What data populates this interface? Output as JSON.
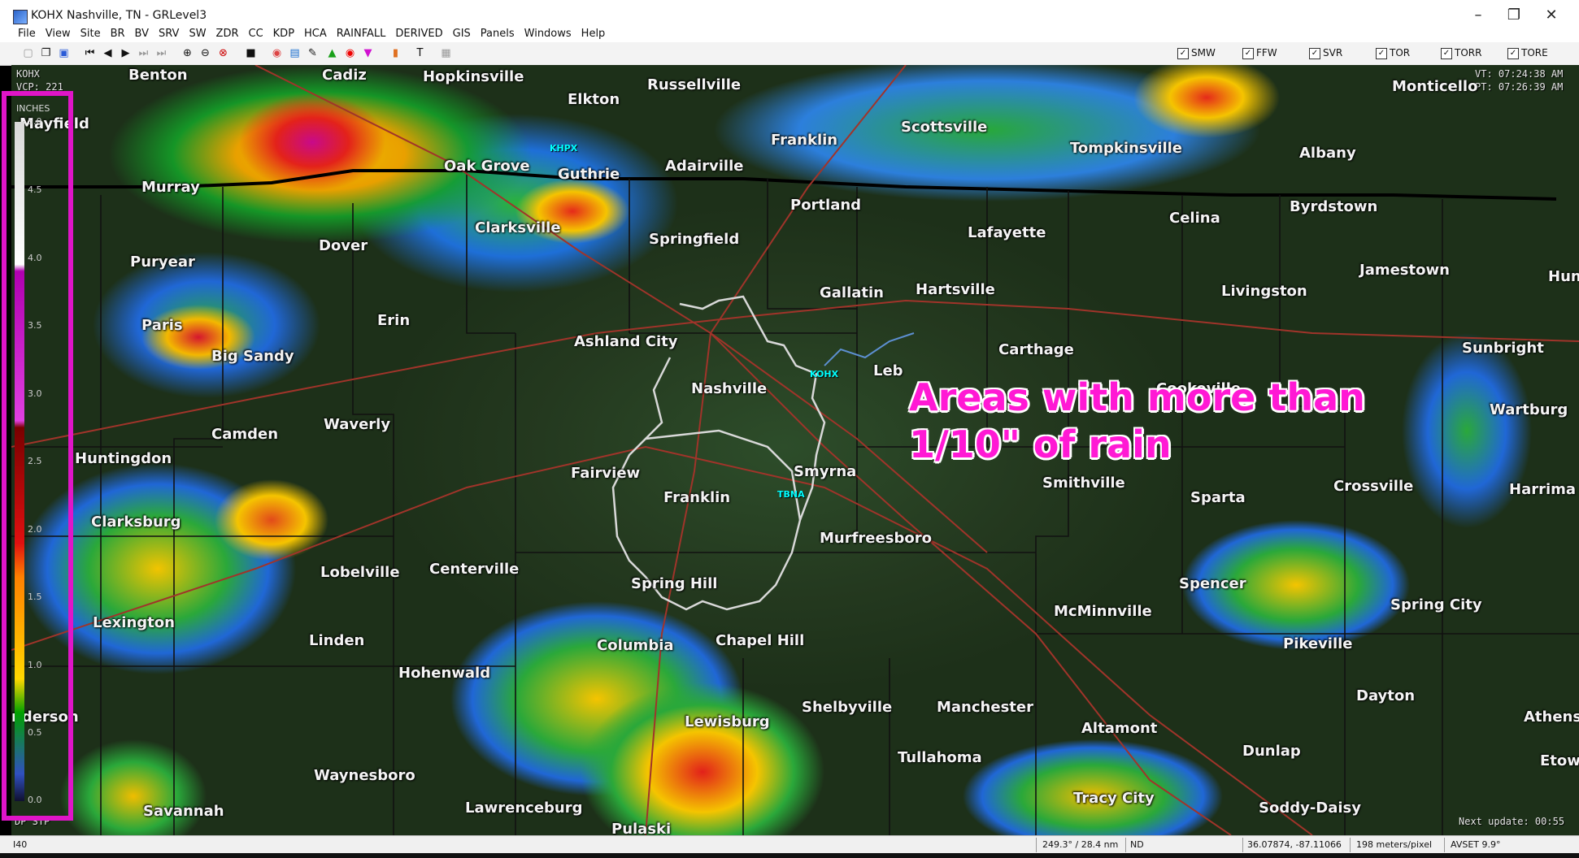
{
  "window": {
    "title": "KOHX Nashville, TN - GRLevel3",
    "controls": [
      "–",
      "❐",
      "✕"
    ]
  },
  "menu": [
    "File",
    "View",
    "Site",
    "BR",
    "BV",
    "SRV",
    "SW",
    "ZDR",
    "CC",
    "KDP",
    "HCA",
    "RAINFALL",
    "DERIVED",
    "GIS",
    "Panels",
    "Windows",
    "Help"
  ],
  "toolbar_icons": [
    "copy-icon",
    "copy-image-icon",
    "export-icon",
    "first-frame-icon",
    "prev-frame-icon",
    "play-icon",
    "next-frame-icon",
    "last-frame-icon",
    "zoom-in-icon",
    "zoom-out-icon",
    "zoom-reset-icon",
    "stop-icon",
    "radar-icon",
    "layers-icon",
    "pen-icon",
    "triangle-green-icon",
    "circle-red-icon",
    "triangle-magenta-icon",
    "fill-icon",
    "text-icon",
    "grid-icon"
  ],
  "warnings": [
    {
      "label": "SMW",
      "checked": true
    },
    {
      "label": "FFW",
      "checked": true
    },
    {
      "label": "SVR",
      "checked": true
    },
    {
      "label": "TOR",
      "checked": true
    },
    {
      "label": "TORR",
      "checked": true
    },
    {
      "label": "TORE",
      "checked": true
    }
  ],
  "hud": {
    "site": "KOHX",
    "vcp": "VCP: 221",
    "vt": "VT: 07:24:38 AM",
    "pt": "PT: 07:26:39 AM",
    "product": "DP STP",
    "next_update": "Next update: 00:55"
  },
  "legend": {
    "unit": "INCHES",
    "ticks": [
      "5.0",
      "4.5",
      "4.0",
      "3.5",
      "3.0",
      "2.5",
      "2.0",
      "1.5",
      "1.0",
      "0.5",
      "0.0"
    ]
  },
  "annotation": {
    "line1": "Areas with more than",
    "line2": "1/10\" of rain"
  },
  "radar_sites": [
    "KHPX",
    "KOHX",
    "TBNA"
  ],
  "cities": {
    "benton": "Benton",
    "cadiz": "Cadiz",
    "hopkinsville": "Hopkinsville",
    "russellville": "Russellville",
    "elkton": "Elkton",
    "monticello": "Monticello",
    "mayfield": "Mayfield",
    "franklin_ky": "Franklin",
    "scottsville": "Scottsville",
    "murray": "Murray",
    "oak_grove": "Oak Grove",
    "guthrie": "Guthrie",
    "adairville": "Adairville",
    "tompkinsville": "Tompkinsville",
    "albany": "Albany",
    "clarksville": "Clarksville",
    "dover": "Dover",
    "springfield": "Springfield",
    "portland": "Portland",
    "lafayette": "Lafayette",
    "celina": "Celina",
    "byrdstown": "Byrdstown",
    "puryear": "Puryear",
    "jamestown": "Jamestown",
    "hunts": "Hunts",
    "gallatin": "Gallatin",
    "hartsville": "Hartsville",
    "livingston": "Livingston",
    "paris": "Paris",
    "erin": "Erin",
    "big_sandy": "Big Sandy",
    "ashland_city": "Ashland City",
    "carthage": "Carthage",
    "sunbright": "Sunbright",
    "leb": "Leb",
    "nashville": "Nashville",
    "cookeville": "Cookeville",
    "camden": "Camden",
    "waverly": "Waverly",
    "wartburg": "Wartburg",
    "huntingdon": "Huntingdon",
    "fairview": "Fairview",
    "smyrna": "Smyrna",
    "smithville": "Smithville",
    "crossville": "Crossville",
    "harriman": "Harrima",
    "franklin_tn": "Franklin",
    "sparta": "Sparta",
    "clarksburg": "Clarksburg",
    "murfreesboro": "Murfreesboro",
    "lobelville": "Lobelville",
    "centerville": "Centerville",
    "spencer": "Spencer",
    "spring_hill": "Spring Hill",
    "mcminnville": "McMinnville",
    "spring_city": "Spring City",
    "lexington": "Lexington",
    "linden": "Linden",
    "columbia": "Columbia",
    "chapel_hill": "Chapel Hill",
    "pikeville": "Pikeville",
    "hohenwald": "Hohenwald",
    "dayton": "Dayton",
    "henderson": "nderson",
    "shelbyville": "Shelbyville",
    "manchester": "Manchester",
    "athens": "Athens",
    "lewisburg": "Lewisburg",
    "altamont": "Altamont",
    "tullahoma": "Tullahoma",
    "dunlap": "Dunlap",
    "etowah": "Etow",
    "waynesboro": "Waynesboro",
    "tracy_city": "Tracy City",
    "savannah": "Savannah",
    "lawrenceburg": "Lawrenceburg",
    "soddy_daisy": "Soddy-Daisy",
    "pulaski": "Pulaski"
  },
  "statusbar": {
    "left": "I40",
    "azimuth": "249.3° / 28.4 nm",
    "value": "ND",
    "coords": "36.07874, -87.11066",
    "resolution": "198 meters/pixel",
    "avset": "AVSET 9.9°"
  },
  "colors": {
    "annotation": "#ff19d4",
    "legend_frame": "#e015c8",
    "site_label": "#00ffff"
  }
}
